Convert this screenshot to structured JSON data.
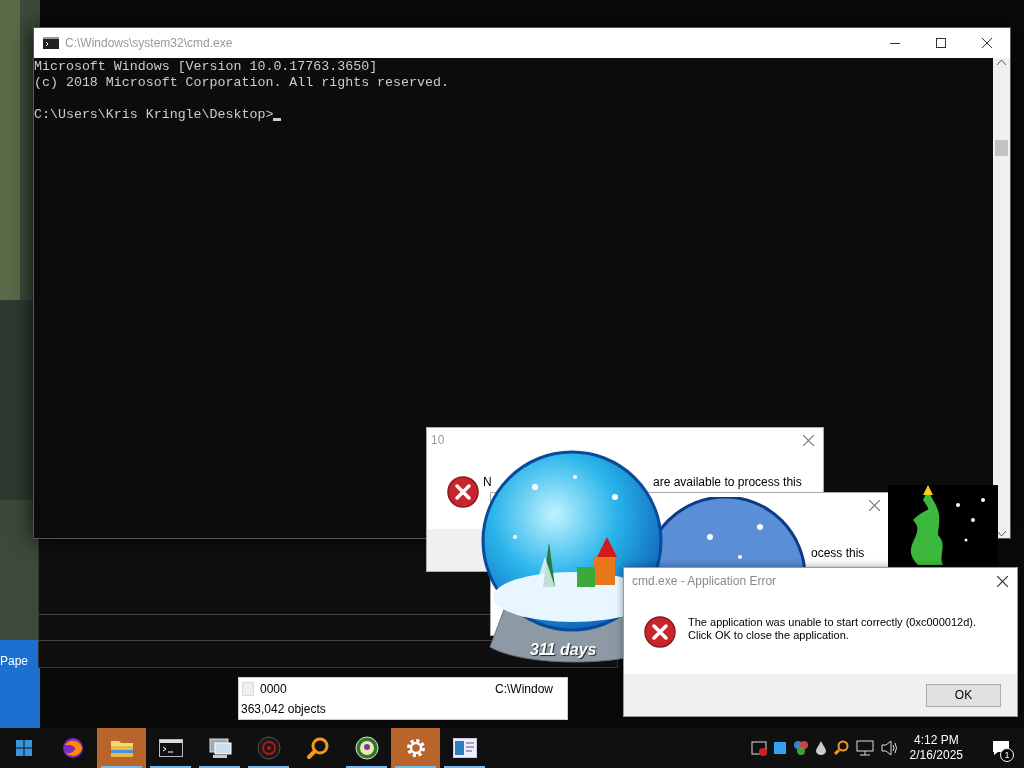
{
  "desktop_icons": [
    {
      "label": "Pape"
    }
  ],
  "cmd_window": {
    "title": "C:\\Windows\\system32\\cmd.exe",
    "lines": [
      "Microsoft Windows [Version 10.0.17763.3650]",
      "(c) 2018 Microsoft Corporation. All rights reserved."
    ],
    "prompt": "C:\\Users\\Kris Kringle\\Desktop>"
  },
  "dialogs": [
    {
      "title": "10",
      "texts": [
        "N",
        "are available to process this"
      ]
    },
    {
      "texts": [
        "ocess this"
      ]
    }
  ],
  "gadget": {
    "label": "311 days"
  },
  "explorer": {
    "row": {
      "name": "0000",
      "path": "C:\\Window"
    },
    "status": "363,042 objects"
  },
  "error_dialog": {
    "title": "cmd.exe - Application Error",
    "message_lines": [
      "The application was unable to start correctly (0xc000012d).",
      "Click OK to close the application."
    ],
    "button": "OK"
  },
  "taskbar": {
    "apps": [
      {
        "kind": "browser",
        "highlighted": false,
        "running": false
      },
      {
        "kind": "folder",
        "highlighted": true,
        "running": true
      },
      {
        "kind": "terminal",
        "highlighted": false,
        "running": true
      },
      {
        "kind": "computer",
        "highlighted": false,
        "running": true
      },
      {
        "kind": "disc",
        "highlighted": false,
        "running": true
      },
      {
        "kind": "magnifier",
        "highlighted": false,
        "running": false
      },
      {
        "kind": "badge",
        "highlighted": false,
        "running": true
      },
      {
        "kind": "gear",
        "highlighted": true,
        "running": true
      },
      {
        "kind": "window",
        "highlighted": false,
        "running": true
      }
    ],
    "time": "4:12 PM",
    "date": "2/16/2025",
    "notification_count": "1"
  }
}
